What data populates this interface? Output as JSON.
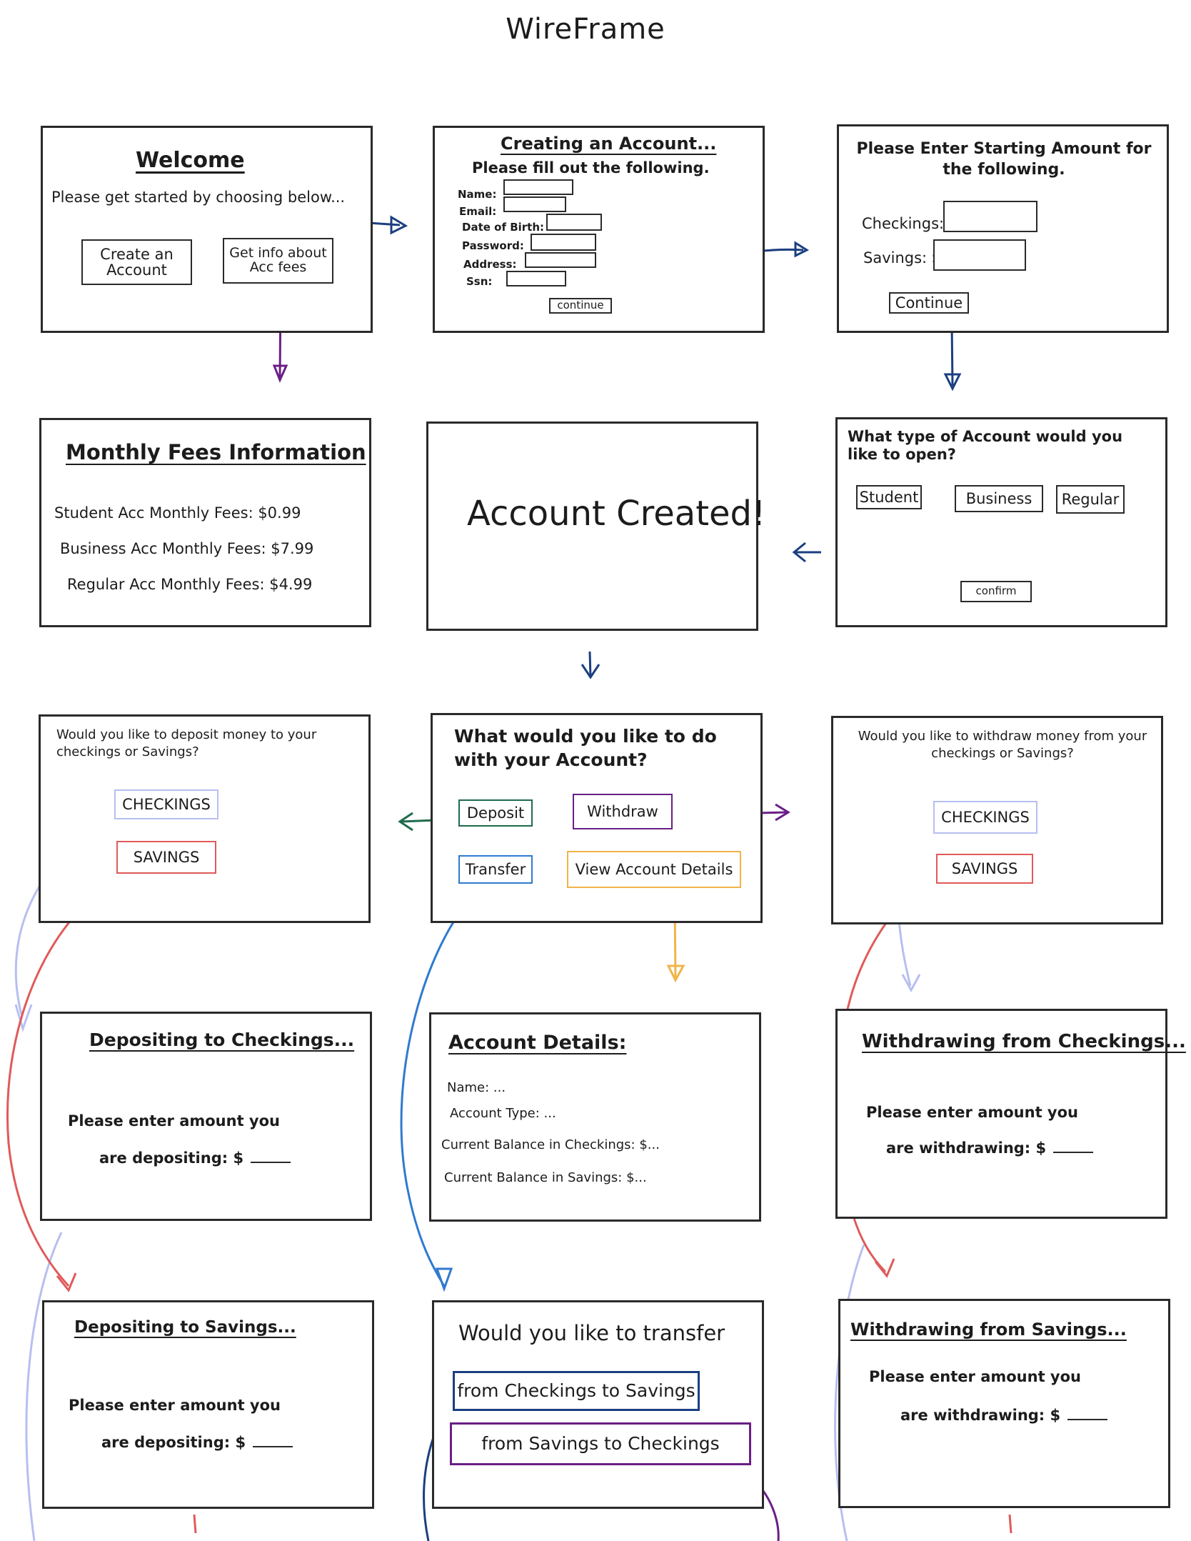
{
  "page_title": "WireFrame",
  "welcome": {
    "heading": "Welcome",
    "prompt": "Please get started by choosing below...",
    "create_button": "Create an Account",
    "fees_button": "Get info about Acc fees"
  },
  "create_account": {
    "heading": "Creating an Account...",
    "subheading": "Please fill out the following.",
    "fields": [
      "Name:",
      "Email:",
      "Date of Birth:",
      "Password:",
      "Address:",
      "Ssn:"
    ],
    "continue_button": "continue"
  },
  "starting_amount": {
    "heading": "Please Enter Starting Amount for the following.",
    "checkings_label": "Checkings: $",
    "savings_label": "Savings: $",
    "continue_button": "Continue"
  },
  "monthly_fees": {
    "heading": "Monthly Fees Information",
    "lines": [
      "Student Acc Monthly Fees: $0.99",
      "Business Acc Monthly Fees: $7.99",
      "Regular Acc Monthly Fees: $4.99"
    ]
  },
  "account_created": {
    "message": "Account Created!"
  },
  "account_type": {
    "question": "What type of Account would you like to open?",
    "options": [
      "Student",
      "Business",
      "Regular"
    ],
    "confirm_button": "confirm"
  },
  "deposit_choice": {
    "question": "Would you like to deposit money to your checkings or Savings?",
    "checkings_button": "CHECKINGS",
    "savings_button": "SAVINGS"
  },
  "main_menu": {
    "question": "What would you like to do with your Account?",
    "deposit_button": "Deposit",
    "withdraw_button": "Withdraw",
    "transfer_button": "Transfer",
    "details_button": "View Account Details"
  },
  "withdraw_choice": {
    "question": "Would you like to withdraw money from your checkings or Savings?",
    "checkings_button": "CHECKINGS",
    "savings_button": "SAVINGS"
  },
  "deposit_checkings": {
    "heading": "Depositing to Checkings...",
    "line1": "Please enter amount you",
    "line2": "are depositing: $"
  },
  "account_details": {
    "heading": "Account Details:",
    "lines": [
      "Name: ...",
      "Account Type: ...",
      "Current Balance in Checkings: $...",
      "Current Balance in Savings: $..."
    ]
  },
  "withdraw_checkings": {
    "heading": "Withdrawing from Checkings...",
    "line1": "Please enter amount you",
    "line2": "are withdrawing: $"
  },
  "deposit_savings": {
    "heading": "Depositing to Savings...",
    "line1": "Please enter amount you",
    "line2": "are depositing: $"
  },
  "transfer": {
    "question": "Would you like to transfer",
    "option1": "from Checkings to Savings",
    "option2": "from Savings to Checkings"
  },
  "withdraw_savings": {
    "heading": "Withdrawing from Savings...",
    "line1": "Please enter amount you",
    "line2": "are withdrawing: $"
  },
  "colors": {
    "ink": "#2a2a2a",
    "navy": "#1b3f80",
    "purple": "#6a1f86",
    "green": "#1f6b4c",
    "blue": "#2f7ad0",
    "orange": "#f0b44a",
    "red": "#e05a5a",
    "lavender": "#b7bff0"
  }
}
